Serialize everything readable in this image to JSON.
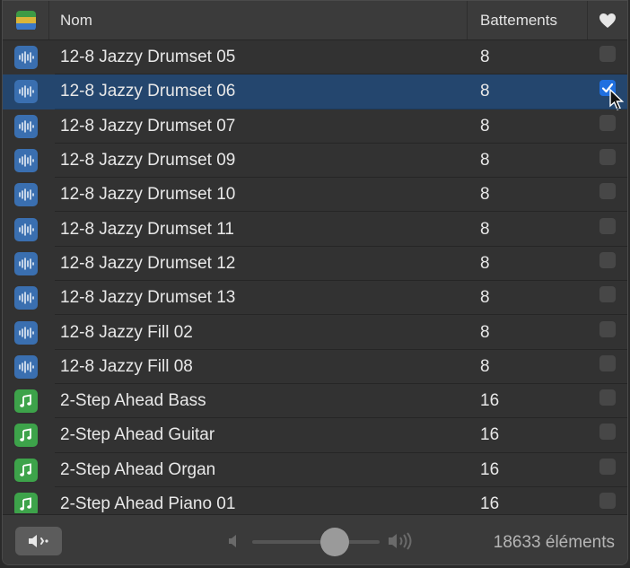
{
  "header": {
    "name_label": "Nom",
    "beats_label": "Battements",
    "layers_icon": "layers-icon",
    "favorite_icon": "heart-icon"
  },
  "rows": [
    {
      "type": "audio",
      "name": "12-8 Jazzy Drumset 05",
      "beats": "8",
      "favorite": false,
      "selected": false
    },
    {
      "type": "audio",
      "name": "12-8 Jazzy Drumset 06",
      "beats": "8",
      "favorite": true,
      "selected": true
    },
    {
      "type": "audio",
      "name": "12-8 Jazzy Drumset 07",
      "beats": "8",
      "favorite": false,
      "selected": false
    },
    {
      "type": "audio",
      "name": "12-8 Jazzy Drumset 09",
      "beats": "8",
      "favorite": false,
      "selected": false
    },
    {
      "type": "audio",
      "name": "12-8 Jazzy Drumset 10",
      "beats": "8",
      "favorite": false,
      "selected": false
    },
    {
      "type": "audio",
      "name": "12-8 Jazzy Drumset 11",
      "beats": "8",
      "favorite": false,
      "selected": false
    },
    {
      "type": "audio",
      "name": "12-8 Jazzy Drumset 12",
      "beats": "8",
      "favorite": false,
      "selected": false
    },
    {
      "type": "audio",
      "name": "12-8 Jazzy Drumset 13",
      "beats": "8",
      "favorite": false,
      "selected": false
    },
    {
      "type": "audio",
      "name": "12-8 Jazzy Fill 02",
      "beats": "8",
      "favorite": false,
      "selected": false
    },
    {
      "type": "audio",
      "name": "12-8 Jazzy Fill 08",
      "beats": "8",
      "favorite": false,
      "selected": false
    },
    {
      "type": "midi",
      "name": "2-Step Ahead Bass",
      "beats": "16",
      "favorite": false,
      "selected": false
    },
    {
      "type": "midi",
      "name": "2-Step Ahead Guitar",
      "beats": "16",
      "favorite": false,
      "selected": false
    },
    {
      "type": "midi",
      "name": "2-Step Ahead Organ",
      "beats": "16",
      "favorite": false,
      "selected": false
    },
    {
      "type": "midi",
      "name": "2-Step Ahead Piano 01",
      "beats": "16",
      "favorite": false,
      "selected": false
    }
  ],
  "footer": {
    "preview_icon": "speaker-preview-icon",
    "volume_level": 0.65,
    "count_text": "18633 éléments"
  },
  "colors": {
    "selection": "#24466e",
    "audio_icon": "#3a6fb0",
    "midi_icon": "#3da34a",
    "checkbox_on": "#1f6fe0"
  }
}
